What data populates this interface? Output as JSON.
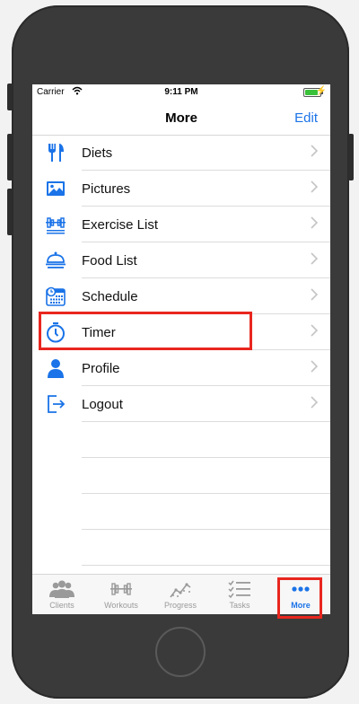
{
  "status": {
    "carrier": "Carrier",
    "time": "9:11 PM",
    "battery_level": 0.9,
    "bolt": "⚡"
  },
  "nav": {
    "title": "More",
    "edit": "Edit"
  },
  "menu": [
    {
      "label": "Diets",
      "icon": "fork-knife-icon"
    },
    {
      "label": "Pictures",
      "icon": "picture-icon"
    },
    {
      "label": "Exercise List",
      "icon": "dumbbell-icon"
    },
    {
      "label": "Food List",
      "icon": "food-cloche-icon"
    },
    {
      "label": "Schedule",
      "icon": "calendar-clock-icon"
    },
    {
      "label": "Timer",
      "icon": "stopwatch-icon"
    },
    {
      "label": "Profile",
      "icon": "person-icon"
    },
    {
      "label": "Logout",
      "icon": "logout-icon"
    }
  ],
  "tabs": [
    {
      "label": "Clients",
      "icon": "people-icon",
      "active": false
    },
    {
      "label": "Workouts",
      "icon": "dumbbell-icon",
      "active": false
    },
    {
      "label": "Progress",
      "icon": "progress-chart-icon",
      "active": false
    },
    {
      "label": "Tasks",
      "icon": "tasks-icon",
      "active": false
    },
    {
      "label": "More",
      "icon": "ellipsis-icon",
      "active": true
    }
  ],
  "colors": {
    "accent": "#1a73e8",
    "highlight": "#e8261f",
    "inactive": "#9a9a9a"
  }
}
